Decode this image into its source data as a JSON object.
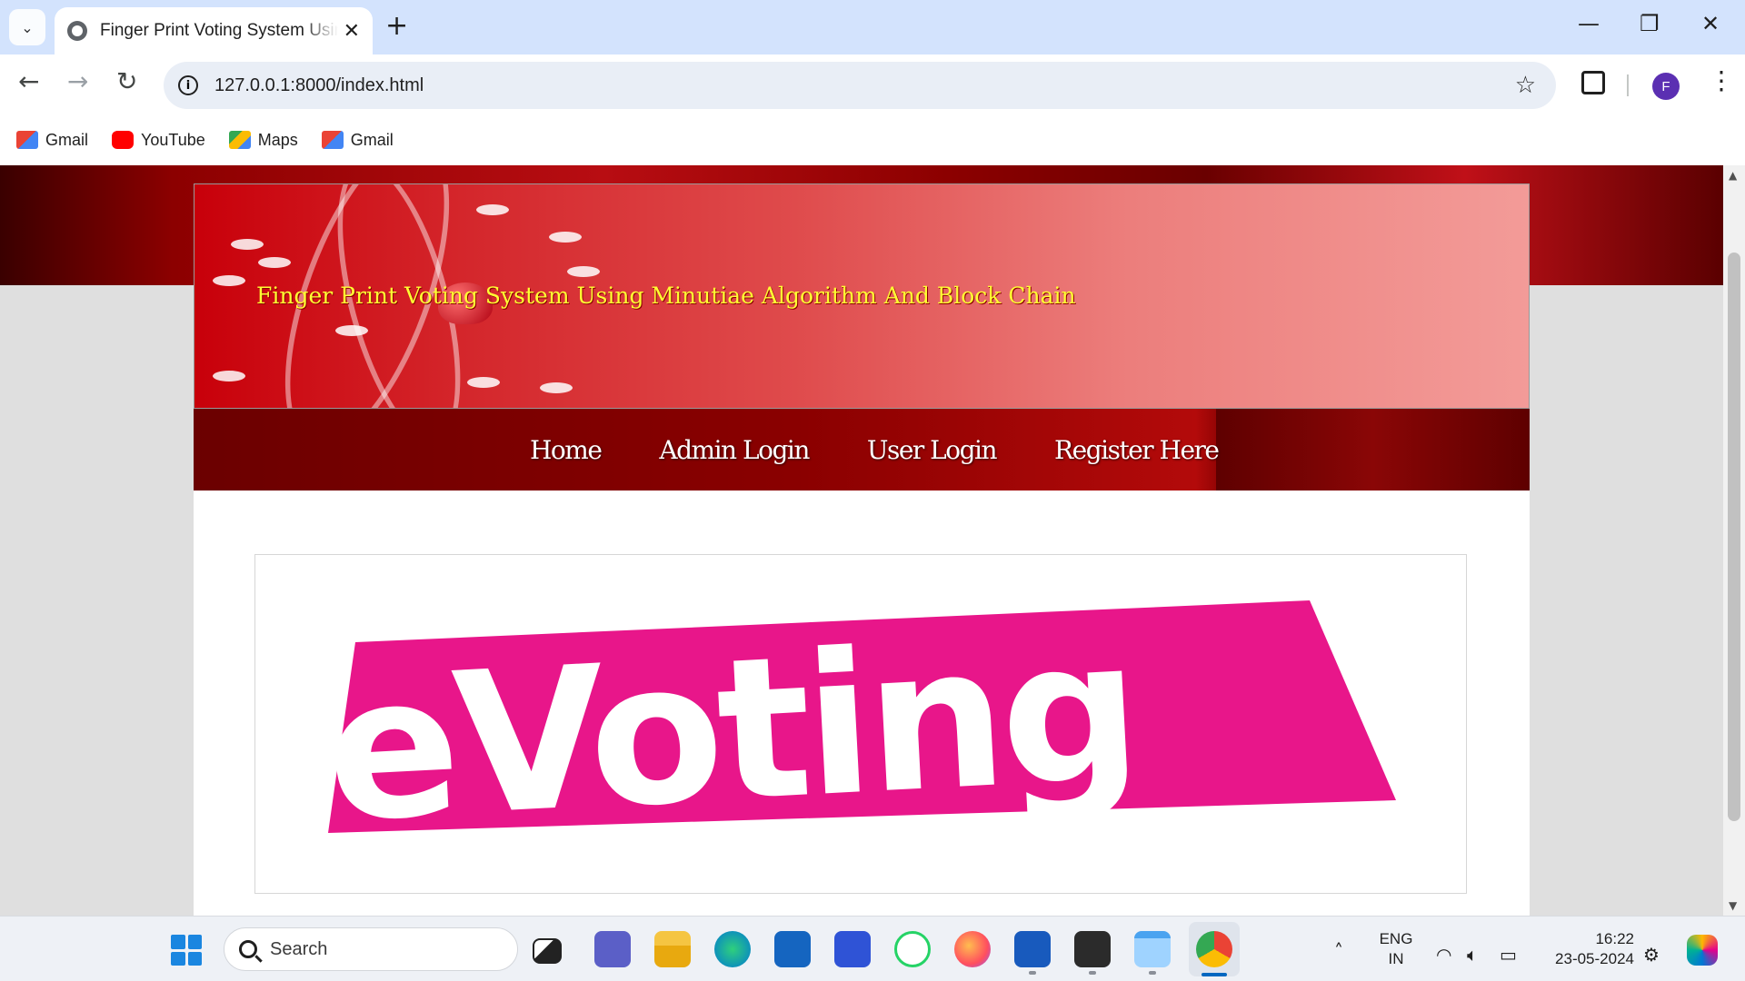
{
  "browser": {
    "tab_title": "Finger Print Voting System Using Minutiae Algorithm And Block Chain",
    "tab_close": "✕",
    "new_tab": "+",
    "url": "127.0.0.1:8000/index.html",
    "profile_initial": "F",
    "bookmarks": [
      "Gmail",
      "YouTube",
      "Maps",
      "Gmail"
    ]
  },
  "page": {
    "banner_title": "Finger Print Voting System Using Minutiae Algorithm And Block Chain",
    "nav": [
      "Home",
      "Admin Login",
      "User Login",
      "Register Here"
    ],
    "logo_text": "eVoting"
  },
  "taskbar": {
    "search_placeholder": "Search",
    "lang_top": "ENG",
    "lang_bottom": "IN",
    "time": "16:22",
    "date": "23-05-2024"
  },
  "colors": {
    "banner_title": "#ffff33",
    "logo_pink": "#e8168a",
    "nav_bg": "#8a0000"
  }
}
